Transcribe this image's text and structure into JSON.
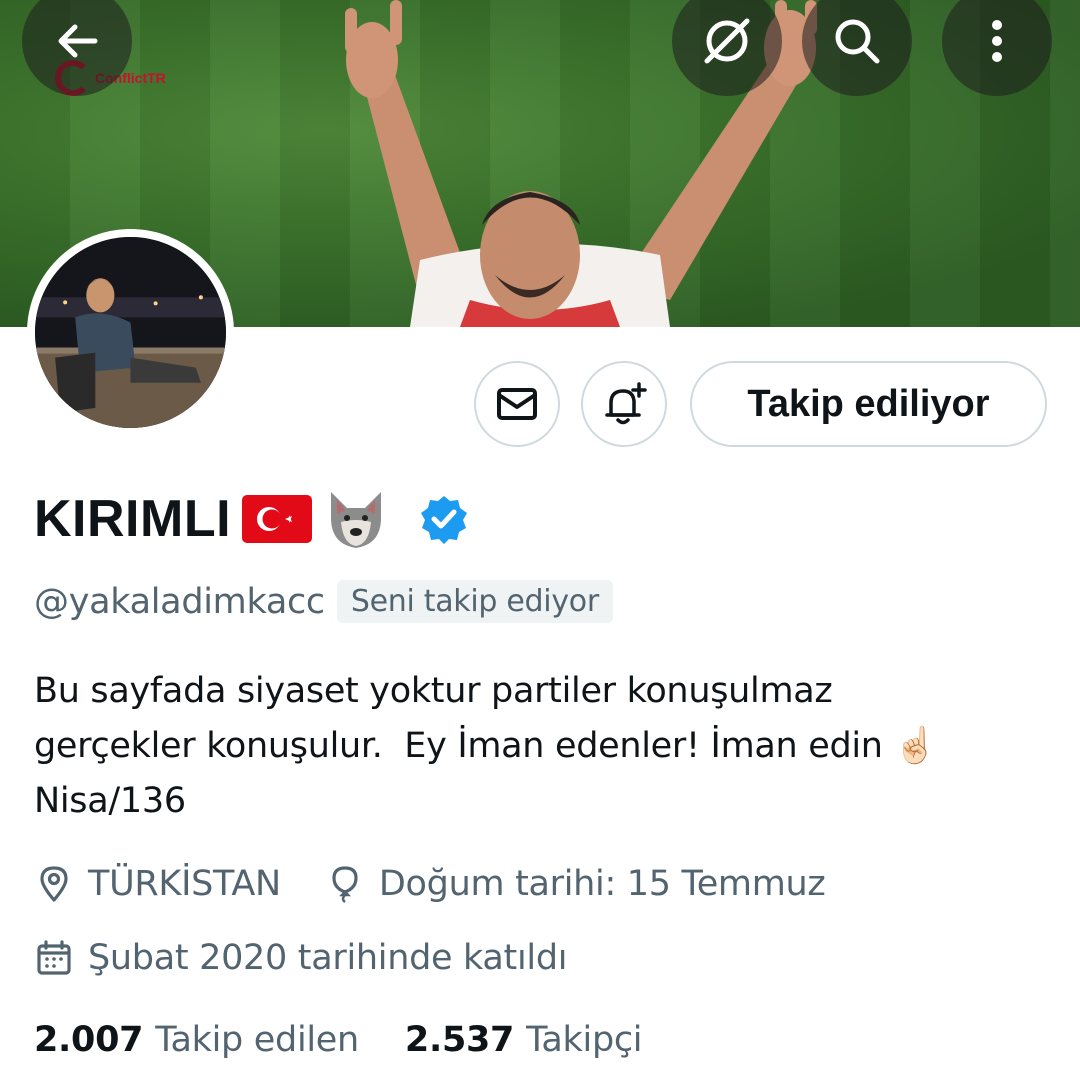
{
  "header": {
    "watermark": "ConflictTR"
  },
  "profile": {
    "display_name": "KIRIMLI",
    "handle": "@yakaladimkacc",
    "follows_you_badge": "Seni takip ediyor",
    "follow_button_label": "Takip ediliyor",
    "bio": "Bu sayfada siyaset yoktur partiler konuşulmaz\ngerçekler konuşulur.  Ey İman edenler! İman edin ☝🏻\nNisa/136",
    "location": "TÜRKİSTAN",
    "birthday": "Doğum tarihi: 15 Temmuz",
    "joined": "Şubat 2020 tarihinde katıldı",
    "following_count": "2.007",
    "following_label": "Takip edilen",
    "followers_count": "2.537",
    "followers_label": "Takipçi"
  },
  "icons": {
    "back": "arrow-left-icon",
    "grok": "grok-icon",
    "search": "search-icon",
    "more": "more-vertical-icon",
    "message": "envelope-icon",
    "notify": "bell-plus-icon",
    "verified": "verified-badge-icon",
    "location": "location-pin-icon",
    "birthday": "balloon-icon",
    "joined": "calendar-icon"
  },
  "colors": {
    "text_primary": "#0f1419",
    "text_secondary": "#536471",
    "border": "#cfd9de",
    "verified_blue": "#1d9bf0",
    "banner_green": "#3b732c",
    "flag_red": "#e30a17"
  }
}
